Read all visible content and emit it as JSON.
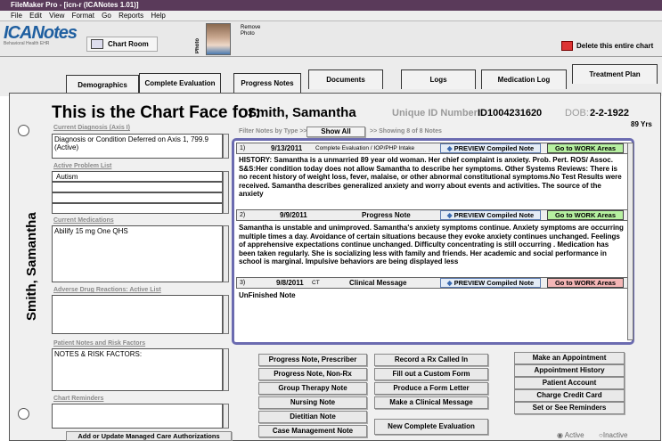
{
  "window": {
    "title": "FileMaker Pro - [icn-r (ICANotes 1.01)]"
  },
  "menu": [
    "File",
    "Edit",
    "View",
    "Format",
    "Go",
    "Reports",
    "Help"
  ],
  "toolbar": {
    "logo": "ICANotes",
    "logo_sub": "Behavioral Health EHR",
    "chart_room": "Chart Room",
    "photo_label": "Photo",
    "remove_photo": "Remove Photo",
    "delete_chart": "Delete this entire chart"
  },
  "tabs": [
    "Demographics",
    "Complete Evaluation",
    "Progress Notes",
    "Documents",
    "Logs",
    "Medication Log",
    "Treatment Plan"
  ],
  "header": {
    "title": "This is the Chart Face for:",
    "patient": "Smith, Samantha",
    "uid_label": "Unique ID Number:",
    "uid": "ID1004231620",
    "dob_label": "DOB:",
    "dob": "2-2-1922",
    "age": "89 Yrs"
  },
  "side_name": "Smith, Samantha",
  "left": {
    "diagnosis_label": "Current Diagnosis (Axis I)",
    "diagnosis": "Diagnosis or Condition Deferred on Axis 1, 799.9 (Active)",
    "problems_label": "Active Problem List",
    "problems": [
      "Autism",
      "",
      "",
      ""
    ],
    "meds_label": "Current Medications",
    "meds": "Abilify 15 mg One QHS",
    "adr_label": "Adverse Drug Reactions: Active List",
    "risk_label": "Patient Notes and Risk Factors",
    "risk": "NOTES & RISK FACTORS:",
    "reminders_label": "Chart Reminders",
    "managed_care": "Add or Update Managed Care Authorizations"
  },
  "filter": {
    "label": "Filter Notes by Type >>",
    "show_all": "Show All",
    "showing": ">> Showing 8 of 8 Notes"
  },
  "notes": [
    {
      "num": "1)",
      "date": "9/13/2011",
      "type": "Complete Evaluation / IOP/PHP Intake",
      "preview": "PREVIEW Compiled Note",
      "work": "Go to WORK Areas",
      "text": "HISTORY: Samantha is a unmarried 89 year old woman. Her chief complaint is anxiety. Prob. Pert. ROS/ Assoc. S&S:Her condition today does not allow Samantha to describe her symptoms. Other Systems Reviews: There is no recent history of weight loss, fever, malaise, or other abnormal constitutional symptoms.No Test Results were received. Samantha describes generalized anxiety and worry about events and activities. The source of the anxiety"
    },
    {
      "num": "2)",
      "date": "9/9/2011",
      "type": "Progress Note",
      "preview": "PREVIEW Compiled Note",
      "work": "Go to WORK Areas",
      "text": "Samantha is unstable and unimproved. Samantha's anxiety symptoms continue. Anxiety symptoms are occurring multiple times a day. Avoidance of certain situations because they evoke anxiety continues unchanged. Feelings of apprehensive expectations continue unchanged. Difficulty concentrating is still occurring . Medication has been taken regularly. She is socializing less with family and friends. Her academic and social performance in school is marginal. Impulsive behaviors are being displayed less"
    },
    {
      "num": "3)",
      "date": "9/8/2011",
      "ct": "CT",
      "type": "Clinical Message",
      "preview": "PREVIEW Compiled Note",
      "work": "Go to WORK Areas",
      "text": "UnFinished Note"
    }
  ],
  "buttons": {
    "col1": [
      "Progress Note, Prescriber",
      "Progress Note, Non-Rx",
      "Group Therapy Note",
      "Nursing Note",
      "Dietitian Note",
      "Case Management Note"
    ],
    "col2": [
      "Record a Rx Called In",
      "Fill out a Custom Form",
      "Produce a Form Letter",
      "Make a Clinical Message",
      "New Complete Evaluation"
    ],
    "col3": [
      "Make an Appointment",
      "Appointment History",
      "Patient Account",
      "Charge Credit Card",
      "Set or See Reminders"
    ]
  },
  "status": {
    "active": "Active",
    "inactive": "Inactive"
  },
  "colors": {
    "titlebar": "#5a3a5a",
    "work_green": "#b6f0a0",
    "work_red": "#f4b6b6",
    "notes_border": "#6b6bb0"
  }
}
